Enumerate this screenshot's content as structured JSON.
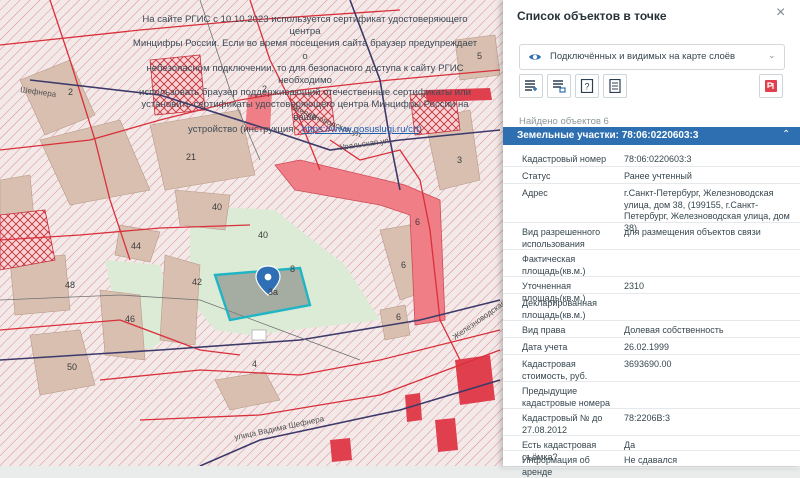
{
  "notice": {
    "line1": "На сайте РГИС с 10.10.2023 используется сертификат удостоверяющего центра",
    "line2": "Минцифры России. Если во время посещения сайта браузер предупреждает о",
    "line3": "небезопасном подключении, то для безопасного доступа к сайту РГИС необходимо",
    "line4": "использовать браузер поддерживающий отечественные сертификаты или",
    "line5": "установить сертификаты удостоверяющего центра Минцифры России на ваше",
    "line6_prefix": "устройство (инструкция - ",
    "link": "https://www.gosuslugi.ru/crt",
    "line6_suffix": ")"
  },
  "map": {
    "building_labels": [
      "2",
      "21",
      "40",
      "40",
      "44",
      "42",
      "48",
      "46",
      "50",
      "4",
      "6",
      "3",
      "5",
      "6",
      "3а",
      "8",
      "6",
      "2"
    ],
    "street_labels": [
      "Железноводская ул.",
      "Уральская ул.",
      "улица Вадима Шефнера",
      "Железноводская ул.",
      "Шефнера"
    ],
    "marker_icon": "location-pin-icon",
    "colors": {
      "highlight": "#1fb5c4",
      "parcel_red": "#e0404e",
      "zone_pink": "#f07e86"
    }
  },
  "panel": {
    "title": "Список объектов в точке",
    "close_icon": "close-icon",
    "layers_select": "Подключённых и видимых на карте слоёв",
    "found": "Найдено объектов 6",
    "section_title": "Земельные участки: 78:06:0220603:3",
    "rows": [
      {
        "label": "Кадастровый номер",
        "value": "78:06:0220603:3"
      },
      {
        "label": "Статус",
        "value": "Ранее учтенный"
      },
      {
        "label": "Адрес",
        "value": "г.Санкт-Петербург, Железноводская улица, дом 38, (199155, г.Санкт-Петербург, Железноводская улица, дом 38)"
      },
      {
        "label": "Вид разрешенного использования",
        "value": "для размещения объектов связи"
      },
      {
        "label": "Фактическая площадь(кв.м.)",
        "value": ""
      },
      {
        "label": "Уточненная площадь(кв.м.)",
        "value": "2310"
      },
      {
        "label": "Декларированная площадь(кв.м.)",
        "value": ""
      },
      {
        "label": "Вид права",
        "value": "Долевая собственность"
      },
      {
        "label": "Дата учета",
        "value": "26.02.1999"
      },
      {
        "label": "Кадастровая стоимость, руб.",
        "value": "3693690.00"
      },
      {
        "label": "Предыдущие кадастровые номера",
        "value": ""
      },
      {
        "label": "Кадастровый № до 27.08.2012",
        "value": "78:2206В:3"
      },
      {
        "label": "Есть кадастровая съёмка?",
        "value": "Да"
      },
      {
        "label": "Информация об аренде",
        "value": "Не сдавался"
      }
    ]
  }
}
